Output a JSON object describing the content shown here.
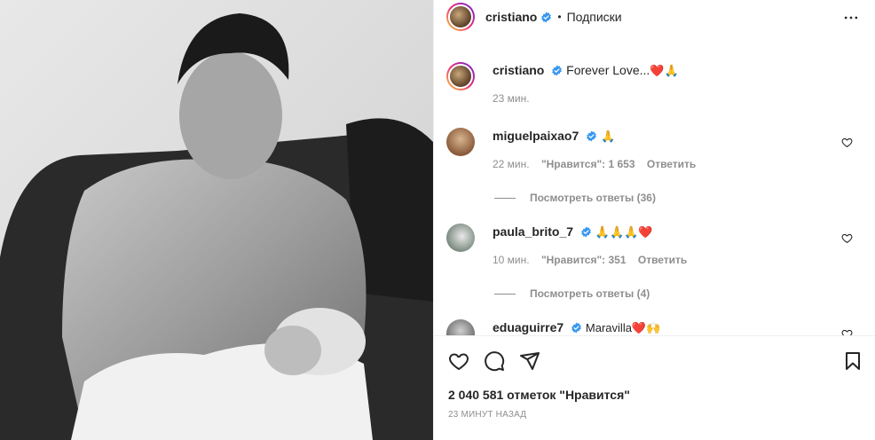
{
  "post": {
    "author": "cristiano",
    "follow_label": "Подписки",
    "separator": "•"
  },
  "caption": {
    "username": "cristiano",
    "text": "Forever Love...",
    "emoji": "❤️🙏",
    "time": "23 мин."
  },
  "comments": [
    {
      "username": "miguelpaixao7",
      "text": "🙏",
      "time": "22 мин.",
      "likes_label": "\"Нравится\": 1 653",
      "reply_label": "Ответить",
      "view_replies": "Посмотреть ответы (36)"
    },
    {
      "username": "paula_brito_7",
      "text": "🙏🙏🙏❤️",
      "time": "10 мин.",
      "likes_label": "\"Нравится\": 351",
      "reply_label": "Ответить",
      "view_replies": "Посмотреть ответы (4)"
    },
    {
      "username": "eduaguirre7",
      "text": "Maravilla❤️🙌"
    }
  ],
  "stats": {
    "likes": "2 040 581 отметок \"Нравится\"",
    "posted": "23 МИНУТ НАЗАД"
  },
  "icons": {
    "verified": "verified-badge-icon",
    "like": "heart-icon",
    "comment": "comment-icon",
    "share": "share-icon",
    "save": "bookmark-icon",
    "more": "more-horizontal-icon"
  },
  "colors": {
    "verified": "#3897f0",
    "text": "#262626",
    "secondary": "#8e8e8e",
    "heart": "#ed4956"
  }
}
